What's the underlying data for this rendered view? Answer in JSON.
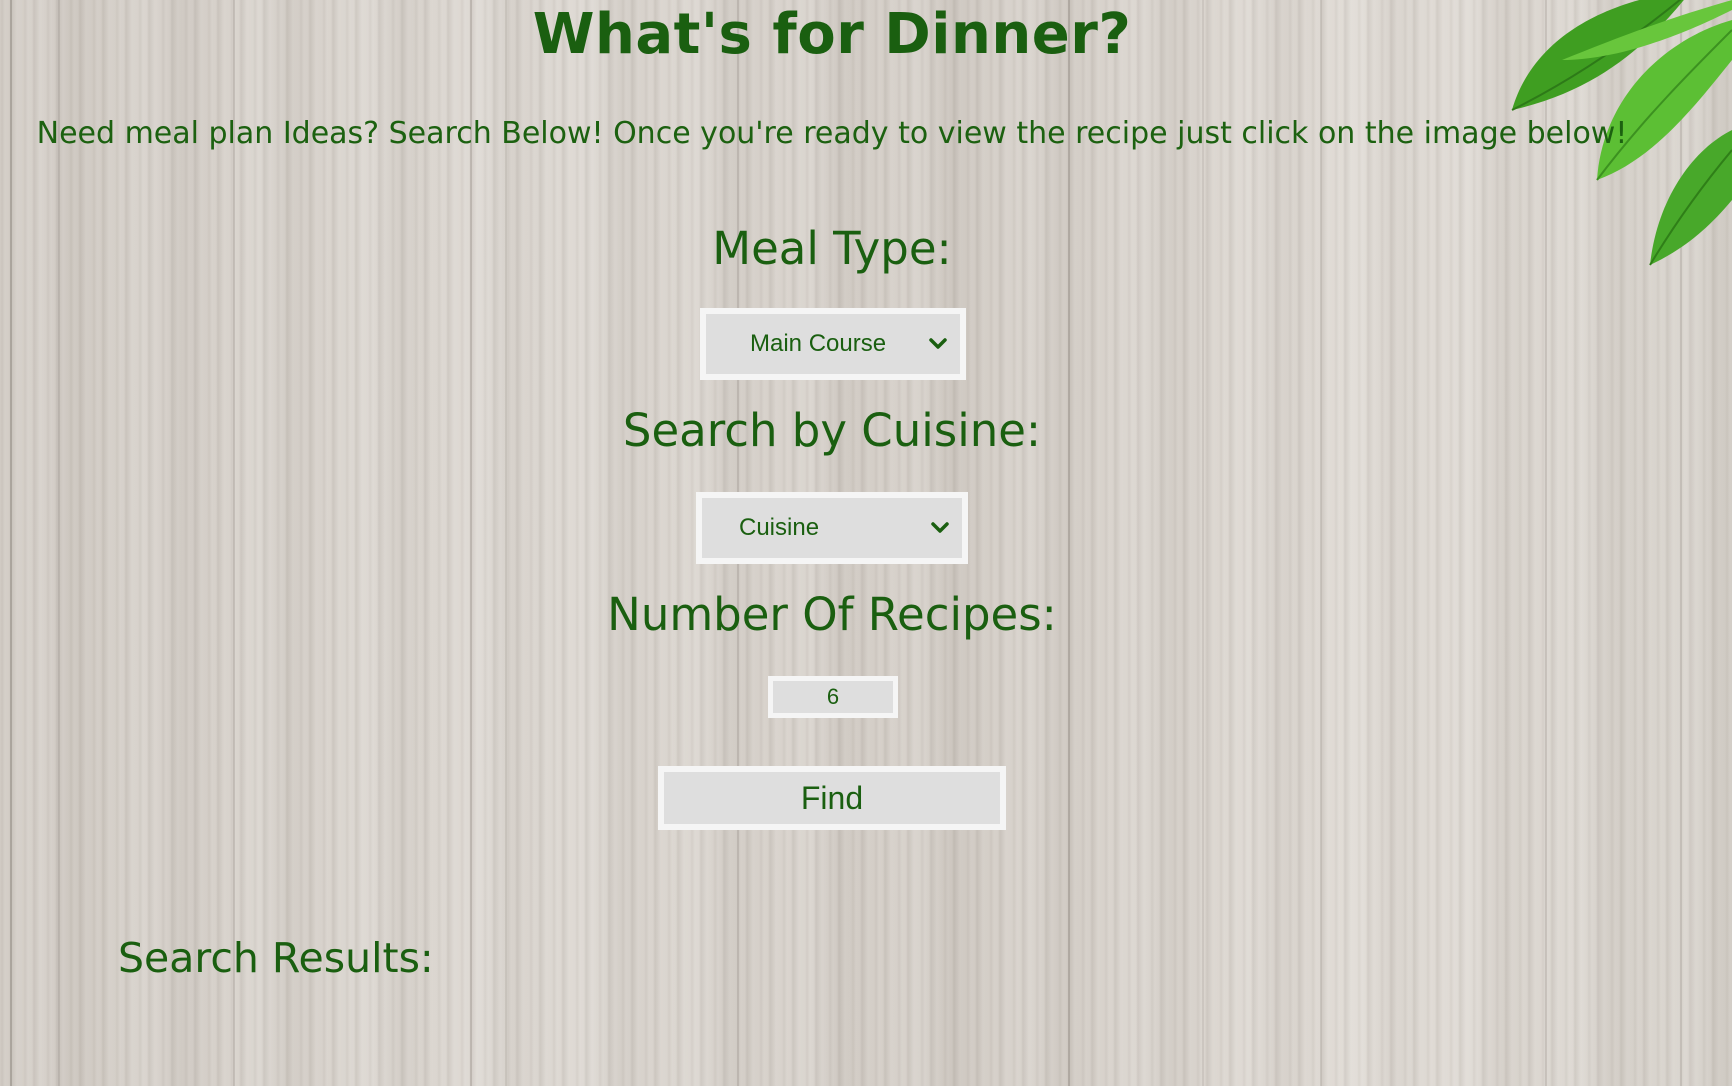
{
  "page": {
    "title": "What's for Dinner?",
    "intro": "Need meal plan Ideas? Search Below! Once you're ready to view the recipe just click on the image below!"
  },
  "form": {
    "meal_type": {
      "label": "Meal Type:",
      "selected": "Main Course"
    },
    "cuisine": {
      "label": "Search by Cuisine:",
      "selected": "Cuisine"
    },
    "recipe_count": {
      "label": "Number Of Recipes:",
      "value": "6"
    },
    "find_label": "Find"
  },
  "results": {
    "heading": "Search Results:",
    "items": []
  },
  "theme": {
    "text_color": "#1c6110",
    "control_bg": "#dedede",
    "control_border": "#f5f5f5",
    "background": "light wood",
    "corner_decoration": "green-leaves"
  }
}
